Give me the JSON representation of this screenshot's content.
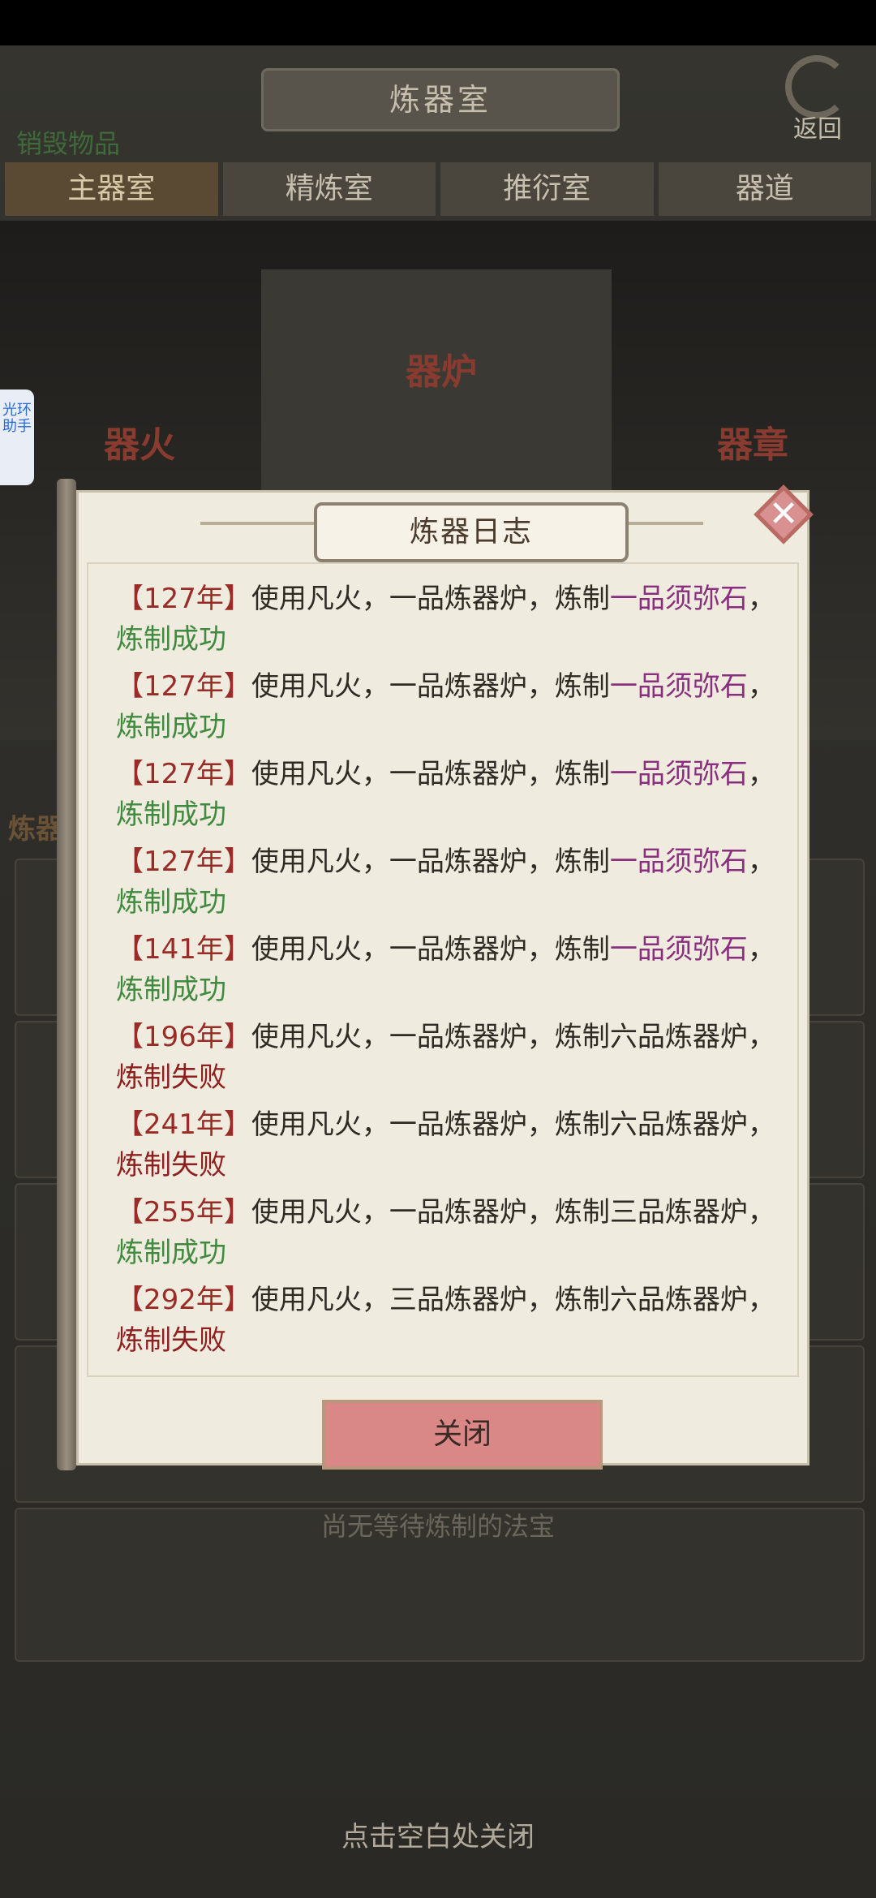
{
  "header": {
    "title": "炼器室",
    "back_label": "返回",
    "destroy_link": "销毁物品"
  },
  "tabs": [
    "主器室",
    "精炼室",
    "推衍室",
    "器道"
  ],
  "scene": {
    "furnace_label": "器炉",
    "fire_label": "器火",
    "chapter_label": "器章",
    "side_label": "炼器"
  },
  "side_helper": "光环助手",
  "empty_queue_text": "尚无等待炼制的法宝",
  "close_hint": "点击空白处关闭",
  "dialog": {
    "title": "炼器日志",
    "close_button": "关闭",
    "entries": [
      {
        "year": "【127年】",
        "text": "使用凡火，一品炼器炉，炼制",
        "item": "一品须弥石",
        "item_color": "purple",
        "suffix": "，",
        "result": "炼制成功",
        "result_type": "success"
      },
      {
        "year": "【127年】",
        "text": "使用凡火，一品炼器炉，炼制",
        "item": "一品须弥石",
        "item_color": "purple",
        "suffix": "，",
        "result": "炼制成功",
        "result_type": "success"
      },
      {
        "year": "【127年】",
        "text": "使用凡火，一品炼器炉，炼制",
        "item": "一品须弥石",
        "item_color": "purple",
        "suffix": "，",
        "result": "炼制成功",
        "result_type": "success"
      },
      {
        "year": "【127年】",
        "text": "使用凡火，一品炼器炉，炼制",
        "item": "一品须弥石",
        "item_color": "purple",
        "suffix": "，",
        "result": "炼制成功",
        "result_type": "success"
      },
      {
        "year": "【141年】",
        "text": "使用凡火，一品炼器炉，炼制",
        "item": "一品须弥石",
        "item_color": "purple",
        "suffix": "，",
        "result": "炼制成功",
        "result_type": "success"
      },
      {
        "year": "【196年】",
        "text": "使用凡火，一品炼器炉，炼制",
        "item": "六品炼器炉",
        "item_color": "plain",
        "suffix": "，",
        "result": "炼制失败",
        "result_type": "fail"
      },
      {
        "year": "【241年】",
        "text": "使用凡火，一品炼器炉，炼制",
        "item": "六品炼器炉",
        "item_color": "plain",
        "suffix": "，",
        "result": "炼制失败",
        "result_type": "fail"
      },
      {
        "year": "【255年】",
        "text": "使用凡火，一品炼器炉，炼制",
        "item": "三品炼器炉",
        "item_color": "plain",
        "suffix": "，",
        "result": "炼制成功",
        "result_type": "success"
      },
      {
        "year": "【292年】",
        "text": "使用凡火，三品炼器炉，炼制",
        "item": "六品炼器炉",
        "item_color": "plain",
        "suffix": "，",
        "result": "炼制失败",
        "result_type": "fail"
      }
    ]
  },
  "colors": {
    "year": "#9a2b26",
    "purple_item": "#8a2f7d",
    "success": "#3f8a3e",
    "fail": "#8e1f1f"
  }
}
